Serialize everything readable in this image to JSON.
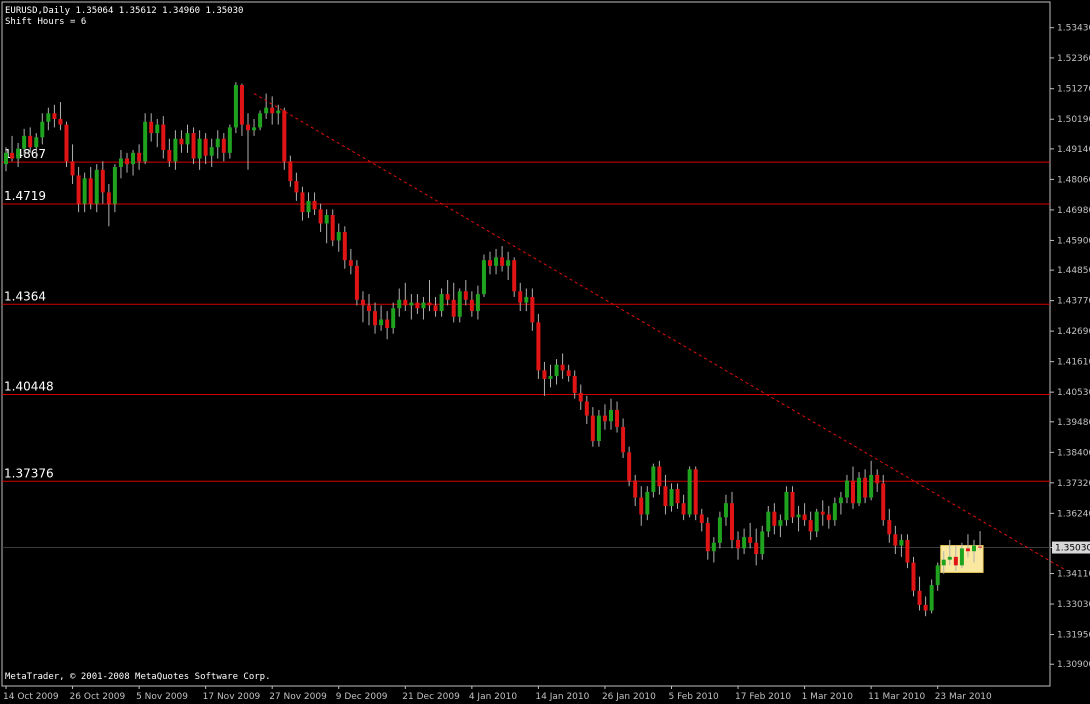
{
  "header": {
    "line1": "EURUSD,Daily  1.35064 1.35612 1.34960 1.35030",
    "line2": "Shift Hours = 6"
  },
  "footer": {
    "copyright": "MetaTrader, © 2001-2008 MetaQuotes Software Corp."
  },
  "colors": {
    "background": "#000000",
    "axis": "#c0c0c0",
    "bull": "#1fa31f",
    "bear": "#e01414",
    "level_line": "#d40000",
    "trendline": "#e01010",
    "highlight_fill": "#fbe8a0",
    "label_text": "#ffffff"
  },
  "chart_data": {
    "type": "candlestick",
    "symbol": "EURUSD",
    "timeframe": "Daily",
    "last_bar": {
      "open": 1.35064,
      "high": 1.35612,
      "low": 1.3496,
      "close": 1.3503
    },
    "current_price_label": "1.35030",
    "y_range": [
      1.302,
      1.5395
    ],
    "y_ticks": [
      "1.53430",
      "1.52360",
      "1.51270",
      "1.50190",
      "1.49140",
      "1.48060",
      "1.46980",
      "1.45900",
      "1.44850",
      "1.43770",
      "1.42690",
      "1.41610",
      "1.40530",
      "1.39480",
      "1.38400",
      "1.37320",
      "1.36240",
      "1.35030",
      "1.34110",
      "1.33030",
      "1.31950",
      "1.30900"
    ],
    "x_labels": [
      "14 Oct 2009",
      "26 Oct 2009",
      "5 Nov 2009",
      "17 Nov 2009",
      "27 Nov 2009",
      "9 Dec 2009",
      "21 Dec 2009",
      "4 Jan 2010",
      "14 Jan 2010",
      "26 Jan 2010",
      "5 Feb 2010",
      "17 Feb 2010",
      "1 Mar 2010",
      "11 Mar 2010",
      "23 Mar 2010"
    ],
    "horizontal_levels": [
      {
        "label": "1.4867",
        "price": 1.4867
      },
      {
        "label": "1.4719",
        "price": 1.4719
      },
      {
        "label": "1.4364",
        "price": 1.4364
      },
      {
        "label": "1.40448",
        "price": 1.40448
      },
      {
        "label": "1.37376",
        "price": 1.37376
      }
    ],
    "trendline": {
      "style": "dashed",
      "start": {
        "bar": 41,
        "price": 1.511
      },
      "end": {
        "bar": 175,
        "price": 1.3425
      }
    },
    "highlight_box": {
      "bar_start": 155,
      "bar_end": 161,
      "price_top": 1.351,
      "price_bottom": 1.3415
    },
    "candles": [
      [
        1.486,
        1.492,
        1.4835,
        1.49
      ],
      [
        1.49,
        1.496,
        1.487,
        1.488
      ],
      [
        1.488,
        1.4935,
        1.485,
        1.4915
      ],
      [
        1.4915,
        1.4985,
        1.489,
        1.496
      ],
      [
        1.496,
        1.499,
        1.49,
        1.492
      ],
      [
        1.492,
        1.497,
        1.488,
        1.4955
      ],
      [
        1.4955,
        1.504,
        1.493,
        1.501
      ],
      [
        1.501,
        1.506,
        1.498,
        1.504
      ],
      [
        1.504,
        1.507,
        1.499,
        1.502
      ],
      [
        1.502,
        1.508,
        1.498,
        1.5
      ],
      [
        1.5,
        1.501,
        1.485,
        1.487
      ],
      [
        1.487,
        1.493,
        1.479,
        1.482
      ],
      [
        1.482,
        1.485,
        1.469,
        1.472
      ],
      [
        1.472,
        1.483,
        1.469,
        1.481
      ],
      [
        1.481,
        1.485,
        1.47,
        1.472
      ],
      [
        1.472,
        1.486,
        1.469,
        1.484
      ],
      [
        1.484,
        1.487,
        1.472,
        1.476
      ],
      [
        1.476,
        1.479,
        1.464,
        1.472
      ],
      [
        1.472,
        1.486,
        1.469,
        1.485
      ],
      [
        1.485,
        1.491,
        1.481,
        1.488
      ],
      [
        1.488,
        1.49,
        1.483,
        1.486
      ],
      [
        1.486,
        1.491,
        1.482,
        1.49
      ],
      [
        1.49,
        1.493,
        1.484,
        1.487
      ],
      [
        1.487,
        1.504,
        1.486,
        1.501
      ],
      [
        1.501,
        1.504,
        1.494,
        1.497
      ],
      [
        1.497,
        1.502,
        1.492,
        1.5
      ],
      [
        1.5,
        1.503,
        1.488,
        1.491
      ],
      [
        1.491,
        1.495,
        1.485,
        1.487
      ],
      [
        1.487,
        1.498,
        1.484,
        1.495
      ],
      [
        1.495,
        1.498,
        1.49,
        1.493
      ],
      [
        1.493,
        1.5,
        1.49,
        1.497
      ],
      [
        1.497,
        1.499,
        1.486,
        1.488
      ],
      [
        1.488,
        1.498,
        1.484,
        1.495
      ],
      [
        1.495,
        1.497,
        1.486,
        1.489
      ],
      [
        1.489,
        1.495,
        1.485,
        1.492
      ],
      [
        1.492,
        1.498,
        1.488,
        1.495
      ],
      [
        1.495,
        1.497,
        1.487,
        1.49
      ],
      [
        1.49,
        1.5,
        1.488,
        1.499
      ],
      [
        1.499,
        1.515,
        1.497,
        1.514
      ],
      [
        1.514,
        1.5145,
        1.496,
        1.5
      ],
      [
        1.5,
        1.504,
        1.484,
        1.498
      ],
      [
        1.498,
        1.502,
        1.496,
        1.499
      ],
      [
        1.499,
        1.505,
        1.498,
        1.504
      ],
      [
        1.504,
        1.511,
        1.502,
        1.506
      ],
      [
        1.506,
        1.51,
        1.5,
        1.504
      ],
      [
        1.504,
        1.507,
        1.5,
        1.505
      ],
      [
        1.505,
        1.506,
        1.484,
        1.487
      ],
      [
        1.487,
        1.489,
        1.478,
        1.48
      ],
      [
        1.48,
        1.483,
        1.473,
        1.476
      ],
      [
        1.476,
        1.478,
        1.466,
        1.469
      ],
      [
        1.469,
        1.476,
        1.467,
        1.473
      ],
      [
        1.473,
        1.476,
        1.468,
        1.47
      ],
      [
        1.47,
        1.472,
        1.462,
        1.465
      ],
      [
        1.465,
        1.47,
        1.458,
        1.468
      ],
      [
        1.468,
        1.47,
        1.457,
        1.459
      ],
      [
        1.459,
        1.465,
        1.455,
        1.462
      ],
      [
        1.462,
        1.464,
        1.449,
        1.452
      ],
      [
        1.452,
        1.456,
        1.447,
        1.45
      ],
      [
        1.45,
        1.452,
        1.436,
        1.438
      ],
      [
        1.438,
        1.441,
        1.43,
        1.436
      ],
      [
        1.436,
        1.44,
        1.429,
        1.434
      ],
      [
        1.434,
        1.437,
        1.426,
        1.429
      ],
      [
        1.429,
        1.436,
        1.427,
        1.431
      ],
      [
        1.431,
        1.434,
        1.424,
        1.428
      ],
      [
        1.428,
        1.437,
        1.426,
        1.435
      ],
      [
        1.435,
        1.442,
        1.432,
        1.438
      ],
      [
        1.438,
        1.444,
        1.434,
        1.436
      ],
      [
        1.436,
        1.44,
        1.431,
        1.437
      ],
      [
        1.437,
        1.44,
        1.433,
        1.435
      ],
      [
        1.435,
        1.439,
        1.431,
        1.437
      ],
      [
        1.437,
        1.445,
        1.434,
        1.436
      ],
      [
        1.436,
        1.439,
        1.432,
        1.434
      ],
      [
        1.434,
        1.442,
        1.432,
        1.44
      ],
      [
        1.44,
        1.445,
        1.436,
        1.438
      ],
      [
        1.438,
        1.444,
        1.43,
        1.432
      ],
      [
        1.432,
        1.442,
        1.43,
        1.441
      ],
      [
        1.441,
        1.445,
        1.436,
        1.438
      ],
      [
        1.438,
        1.441,
        1.432,
        1.434
      ],
      [
        1.434,
        1.443,
        1.431,
        1.44
      ],
      [
        1.44,
        1.454,
        1.439,
        1.452
      ],
      [
        1.452,
        1.455,
        1.447,
        1.45
      ],
      [
        1.45,
        1.456,
        1.447,
        1.453
      ],
      [
        1.453,
        1.457,
        1.448,
        1.45
      ],
      [
        1.45,
        1.455,
        1.445,
        1.452
      ],
      [
        1.452,
        1.453,
        1.439,
        1.441
      ],
      [
        1.441,
        1.444,
        1.434,
        1.437
      ],
      [
        1.437,
        1.442,
        1.434,
        1.439
      ],
      [
        1.439,
        1.442,
        1.427,
        1.43
      ],
      [
        1.43,
        1.433,
        1.41,
        1.413
      ],
      [
        1.413,
        1.416,
        1.404,
        1.41
      ],
      [
        1.41,
        1.415,
        1.407,
        1.411
      ],
      [
        1.411,
        1.417,
        1.408,
        1.415
      ],
      [
        1.415,
        1.419,
        1.41,
        1.413
      ],
      [
        1.413,
        1.415,
        1.409,
        1.411
      ],
      [
        1.411,
        1.413,
        1.403,
        1.405
      ],
      [
        1.405,
        1.408,
        1.399,
        1.402
      ],
      [
        1.402,
        1.404,
        1.394,
        1.397
      ],
      [
        1.397,
        1.4,
        1.386,
        1.388
      ],
      [
        1.388,
        1.399,
        1.386,
        1.397
      ],
      [
        1.397,
        1.401,
        1.392,
        1.395
      ],
      [
        1.395,
        1.403,
        1.392,
        1.399
      ],
      [
        1.399,
        1.402,
        1.391,
        1.393
      ],
      [
        1.393,
        1.396,
        1.382,
        1.384
      ],
      [
        1.384,
        1.386,
        1.372,
        1.374
      ],
      [
        1.374,
        1.376,
        1.365,
        1.368
      ],
      [
        1.368,
        1.372,
        1.358,
        1.362
      ],
      [
        1.362,
        1.372,
        1.36,
        1.37
      ],
      [
        1.37,
        1.38,
        1.368,
        1.379
      ],
      [
        1.379,
        1.381,
        1.369,
        1.372
      ],
      [
        1.372,
        1.376,
        1.362,
        1.365
      ],
      [
        1.365,
        1.373,
        1.363,
        1.371
      ],
      [
        1.371,
        1.373,
        1.364,
        1.366
      ],
      [
        1.366,
        1.369,
        1.36,
        1.362
      ],
      [
        1.362,
        1.379,
        1.361,
        1.378
      ],
      [
        1.378,
        1.379,
        1.36,
        1.362
      ],
      [
        1.362,
        1.364,
        1.356,
        1.359
      ],
      [
        1.359,
        1.361,
        1.346,
        1.349
      ],
      [
        1.349,
        1.354,
        1.345,
        1.352
      ],
      [
        1.352,
        1.363,
        1.35,
        1.361
      ],
      [
        1.361,
        1.369,
        1.358,
        1.366
      ],
      [
        1.366,
        1.37,
        1.35,
        1.353
      ],
      [
        1.353,
        1.356,
        1.346,
        1.35
      ],
      [
        1.35,
        1.357,
        1.348,
        1.354
      ],
      [
        1.354,
        1.359,
        1.35,
        1.352
      ],
      [
        1.352,
        1.357,
        1.344,
        1.348
      ],
      [
        1.348,
        1.358,
        1.346,
        1.356
      ],
      [
        1.356,
        1.365,
        1.354,
        1.363
      ],
      [
        1.363,
        1.366,
        1.355,
        1.358
      ],
      [
        1.358,
        1.362,
        1.354,
        1.36
      ],
      [
        1.36,
        1.372,
        1.358,
        1.37
      ],
      [
        1.37,
        1.372,
        1.359,
        1.361
      ],
      [
        1.361,
        1.365,
        1.356,
        1.362
      ],
      [
        1.362,
        1.366,
        1.358,
        1.36
      ],
      [
        1.36,
        1.363,
        1.353,
        1.356
      ],
      [
        1.356,
        1.364,
        1.354,
        1.363
      ],
      [
        1.363,
        1.367,
        1.358,
        1.362
      ],
      [
        1.362,
        1.365,
        1.357,
        1.36
      ],
      [
        1.36,
        1.368,
        1.358,
        1.366
      ],
      [
        1.366,
        1.37,
        1.362,
        1.368
      ],
      [
        1.368,
        1.376,
        1.366,
        1.374
      ],
      [
        1.374,
        1.379,
        1.364,
        1.366
      ],
      [
        1.366,
        1.377,
        1.365,
        1.375
      ],
      [
        1.375,
        1.378,
        1.366,
        1.368
      ],
      [
        1.368,
        1.381,
        1.367,
        1.376
      ],
      [
        1.376,
        1.378,
        1.37,
        1.373
      ],
      [
        1.373,
        1.376,
        1.358,
        1.36
      ],
      [
        1.36,
        1.364,
        1.352,
        1.355
      ],
      [
        1.355,
        1.358,
        1.348,
        1.351
      ],
      [
        1.351,
        1.355,
        1.347,
        1.353
      ],
      [
        1.353,
        1.355,
        1.343,
        1.345
      ],
      [
        1.345,
        1.347,
        1.333,
        1.335
      ],
      [
        1.335,
        1.34,
        1.328,
        1.33
      ],
      [
        1.33,
        1.333,
        1.326,
        1.328
      ],
      [
        1.328,
        1.339,
        1.327,
        1.337
      ],
      [
        1.337,
        1.345,
        1.335,
        1.344
      ],
      [
        1.344,
        1.349,
        1.341,
        1.346
      ],
      [
        1.346,
        1.353,
        1.344,
        1.347
      ],
      [
        1.347,
        1.351,
        1.342,
        1.344
      ],
      [
        1.344,
        1.352,
        1.343,
        1.35
      ],
      [
        1.35,
        1.355,
        1.347,
        1.349
      ],
      [
        1.349,
        1.353,
        1.345,
        1.351
      ],
      [
        1.35064,
        1.35612,
        1.3496,
        1.3503
      ]
    ]
  }
}
